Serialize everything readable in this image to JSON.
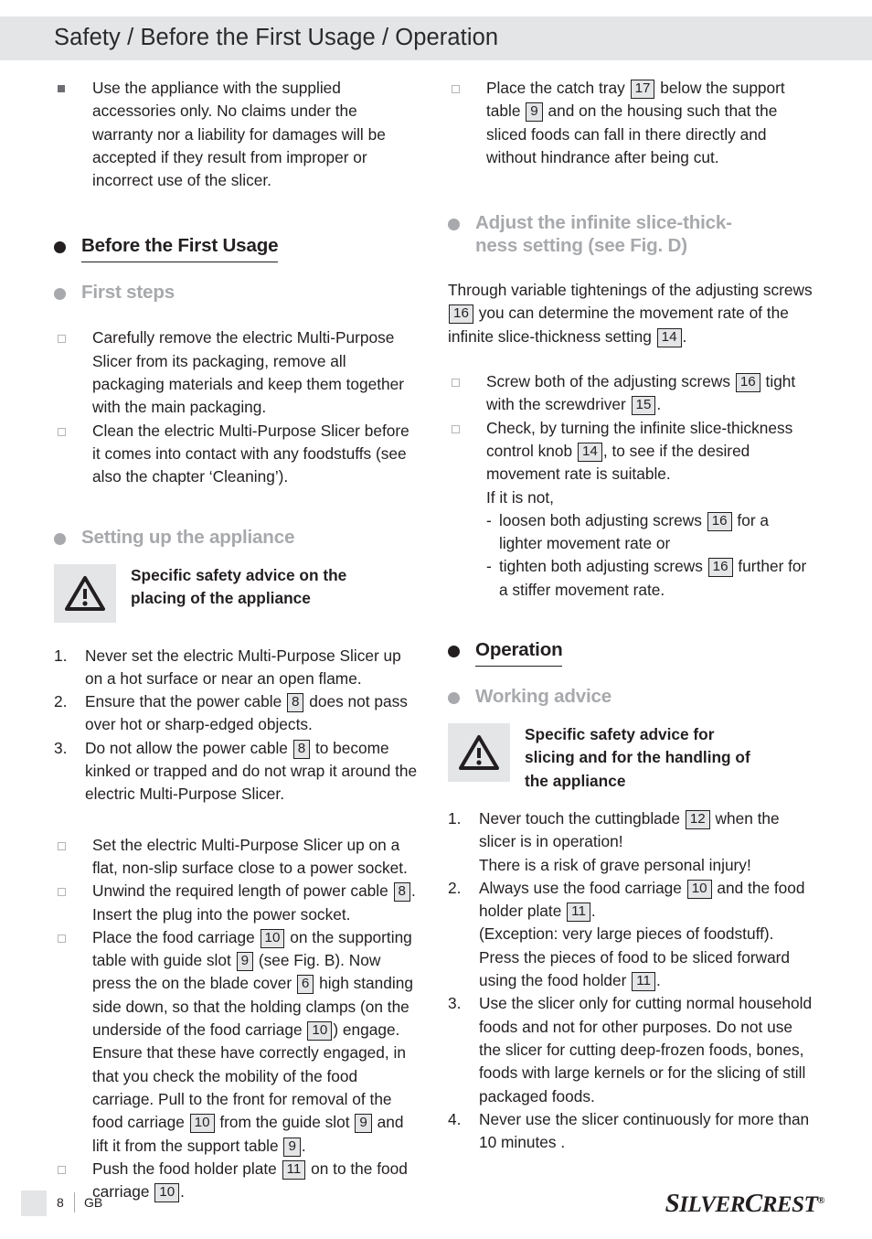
{
  "header": {
    "title": "Safety / Before the First Usage / Operation",
    "band_color": "#e4e5e7"
  },
  "left_column": {
    "intro_bullet": "Use the appliance with the supplied accessories only. No claims under the warranty nor a liability for damages will be accepted if they result from improper or incorrect use of the slicer.",
    "heading_before_first_usage": "Before the First Usage",
    "heading_first_steps": "First steps",
    "first_steps_items": [
      "Carefully remove the electric Multi-Purpose Slicer from its packaging, remove all packaging materials and keep them together with the main packaging.",
      "Clean the electric Multi-Purpose Slicer before it comes into contact with any foodstuffs (see also the chapter ‘Cleaning’)."
    ],
    "heading_setting_up": "Setting up the appliance",
    "warning_placing": {
      "icon": "warning-triangle-icon",
      "line1": "Specific safety advice on the",
      "line2": "placing of the appliance"
    },
    "numbered_items": [
      {
        "num": "1.",
        "text": "Never set the electric Multi-Purpose Slicer up on a hot surface or near an open flame."
      },
      {
        "num": "2.",
        "pre": "Ensure that the power cable ",
        "ref": "8",
        "post": " does not pass over hot or sharp-edged objects."
      },
      {
        "num": "3.",
        "pre": "Do not allow the power cable ",
        "ref": "8",
        "post": " to become kinked or trapped and do not wrap it around the electric Multi-Purpose Slicer."
      }
    ],
    "setup_items": [
      {
        "text": "Set the electric Multi-Purpose Slicer up on a flat, non-slip surface close to a power socket."
      },
      {
        "pre": "Unwind the required length of power cable ",
        "ref": "8",
        "post": ". Insert the plug into the power socket."
      },
      {
        "seg": [
          {
            "t": "Place the food carriage "
          },
          {
            "r": "10"
          },
          {
            "t": " on the supporting table with guide slot "
          },
          {
            "r": "9"
          },
          {
            "t": " (see Fig. B). Now press the on the blade cover "
          },
          {
            "r": "6"
          },
          {
            "t": " high standing side down, so that the holding clamps (on the underside of the food carriage "
          },
          {
            "r": "10"
          },
          {
            "t": ") engage. Ensure that these have correctly engaged, in that you check the mobility of the food carriage. Pull to the front for removal of the food carriage "
          },
          {
            "r": "10"
          },
          {
            "t": " from the guide slot "
          },
          {
            "r": "9"
          },
          {
            "t": " and lift it from the support table "
          },
          {
            "r": "9"
          },
          {
            "t": "."
          }
        ]
      },
      {
        "seg": [
          {
            "t": "Push the food holder plate "
          },
          {
            "r": "11"
          },
          {
            "t": " on to the food carriage "
          },
          {
            "r": "10"
          },
          {
            "t": "."
          }
        ]
      }
    ]
  },
  "right_column": {
    "catch_tray_item": {
      "seg": [
        {
          "t": "Place the catch tray "
        },
        {
          "r": "17"
        },
        {
          "t": " below the support table "
        },
        {
          "r": "9"
        },
        {
          "t": " and on the housing such that the sliced foods can fall in there directly and without hindrance after being cut."
        }
      ]
    },
    "heading_adjust_line1": "Adjust the infinite slice-thick-",
    "heading_adjust_line2": "ness setting (see Fig. D)",
    "adjust_intro": {
      "seg": [
        {
          "t": "Through variable tightenings of the adjusting screws "
        },
        {
          "r": "16"
        },
        {
          "t": " you can determine the movement rate of the infinite slice-thickness setting "
        },
        {
          "r": "14"
        },
        {
          "t": "."
        }
      ]
    },
    "adjust_items": [
      {
        "seg": [
          {
            "t": "Screw both of the adjusting screws "
          },
          {
            "r": "16"
          },
          {
            "t": " tight with the screwdriver "
          },
          {
            "r": "15"
          },
          {
            "t": "."
          }
        ]
      },
      {
        "seg": [
          {
            "t": "Check, by turning the infinite slice-thickness control knob "
          },
          {
            "r": "14"
          },
          {
            "t": ", to see if the desired movement rate is suitable."
          }
        ],
        "extra_line": "If it is not,",
        "dashes": [
          {
            "pre": "loosen both adjusting screws ",
            "ref": "16",
            "post": " for a lighter movement rate or"
          },
          {
            "pre": "tighten both adjusting screws ",
            "ref": "16",
            "post": " further for a stiffer movement rate."
          }
        ]
      }
    ],
    "heading_operation": "Operation",
    "heading_working_advice": "Working advice",
    "warning_slicing": {
      "icon": "warning-triangle-icon",
      "line1": "Specific safety advice for",
      "line2": "slicing and for the handling of",
      "line3": "the appliance"
    },
    "operation_items": [
      {
        "num": "1.",
        "seg": [
          {
            "t": "Never touch the cuttingblade "
          },
          {
            "r": "12"
          },
          {
            "t": " when the slicer is in operation!"
          }
        ],
        "extra_lines": [
          "There is a risk of grave personal injury!"
        ]
      },
      {
        "num": "2.",
        "seg": [
          {
            "t": "Always use the food carriage "
          },
          {
            "r": "10"
          },
          {
            "t": " and the food holder plate "
          },
          {
            "r": "11"
          },
          {
            "t": "."
          }
        ],
        "extra_seg": [
          {
            "t": "(Exception: very large pieces of foodstuff). Press the pieces of food to be sliced forward using the food holder "
          },
          {
            "r": "11"
          },
          {
            "t": "."
          }
        ]
      },
      {
        "num": "3.",
        "seg": [
          {
            "t": "Use the slicer only for cutting normal household foods and not for other purposes. Do not use the slicer for cutting deep-frozen foods, bones, foods with large kernels or for the slicing of still packaged foods."
          }
        ]
      },
      {
        "num": "4.",
        "seg": [
          {
            "t": "Never use the slicer continuously for more than 10 minutes ."
          }
        ]
      }
    ]
  },
  "footer": {
    "page_number": "8",
    "language": "GB",
    "brand_part1": "S",
    "brand_part2": "ILVER",
    "brand_part3": "C",
    "brand_part4": "REST",
    "brand_registered": "®"
  }
}
